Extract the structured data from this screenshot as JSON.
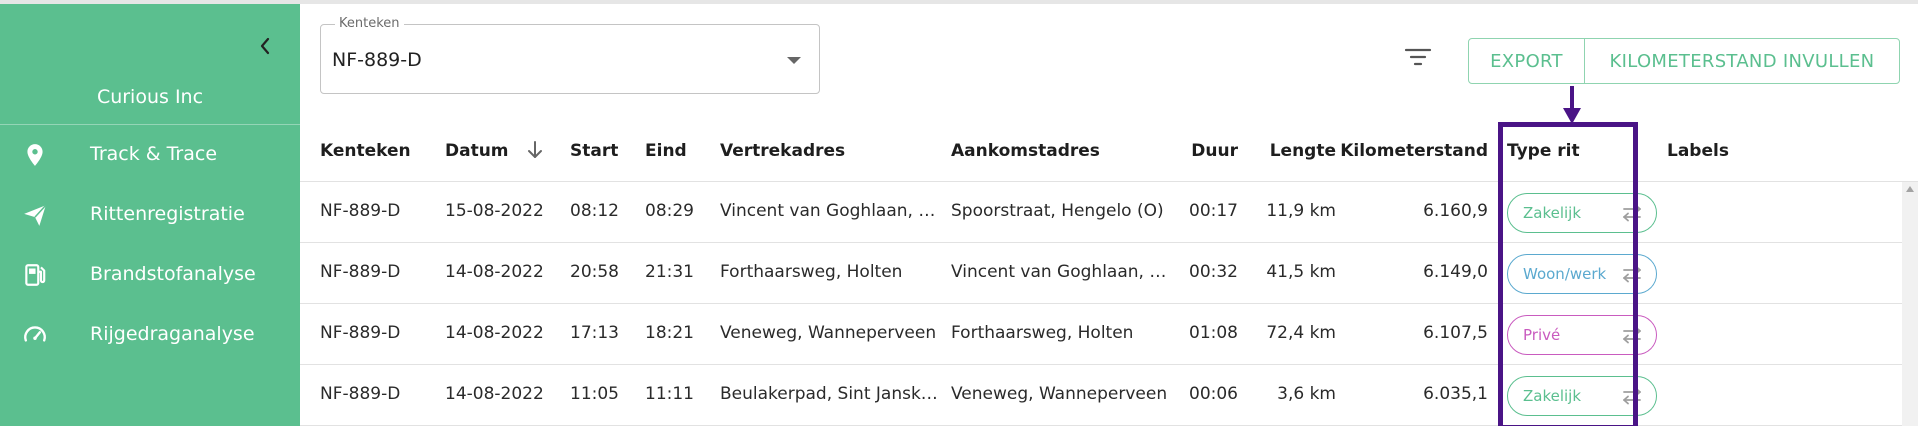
{
  "sidebar": {
    "company": "Curious Inc",
    "items": [
      {
        "label": "Track & Trace",
        "icon": "location-pin-icon"
      },
      {
        "label": "Rittenregistratie",
        "icon": "paper-plane-icon"
      },
      {
        "label": "Brandstofanalyse",
        "icon": "fuel-pump-icon"
      },
      {
        "label": "Rijgedraganalyse",
        "icon": "speedometer-icon"
      }
    ]
  },
  "filter": {
    "label": "Kenteken",
    "value": "NF-889-D"
  },
  "toolbar": {
    "export_label": "EXPORT",
    "km_label": "KILOMETERSTAND INVULLEN"
  },
  "table": {
    "headers": {
      "kenteken": "Kenteken",
      "datum": "Datum",
      "start": "Start",
      "eind": "Eind",
      "vertrek": "Vertrekadres",
      "aankomst": "Aankomstadres",
      "duur": "Duur",
      "lengte": "Lengte",
      "km": "Kilometerstand",
      "type": "Type rit",
      "labels": "Labels"
    },
    "rows": [
      {
        "kenteken": "NF-889-D",
        "datum": "15-08-2022",
        "start": "08:12",
        "eind": "08:29",
        "vertrek": "Vincent van Goghlaan, E...",
        "aankomst": "Spoorstraat, Hengelo (O)",
        "duur": "00:17",
        "lengte": "11,9 km",
        "km": "6.160,9",
        "type": "Zakelijk",
        "type_color": "#5bbf8f"
      },
      {
        "kenteken": "NF-889-D",
        "datum": "14-08-2022",
        "start": "20:58",
        "eind": "21:31",
        "vertrek": "Forthaarsweg, Holten",
        "aankomst": "Vincent van Goghlaan, E...",
        "duur": "00:32",
        "lengte": "41,5 km",
        "km": "6.149,0",
        "type": "Woon/werk",
        "type_color": "#5ba9cf"
      },
      {
        "kenteken": "NF-889-D",
        "datum": "14-08-2022",
        "start": "17:13",
        "eind": "18:21",
        "vertrek": "Veneweg, Wanneperveen",
        "aankomst": "Forthaarsweg, Holten",
        "duur": "01:08",
        "lengte": "72,4 km",
        "km": "6.107,5",
        "type": "Privé",
        "type_color": "#c95bbf"
      },
      {
        "kenteken": "NF-889-D",
        "datum": "14-08-2022",
        "start": "11:05",
        "eind": "11:11",
        "vertrek": "Beulakerpad, Sint Janskl...",
        "aankomst": "Veneweg, Wanneperveen",
        "duur": "00:06",
        "lengte": "3,6 km",
        "km": "6.035,1",
        "type": "Zakelijk",
        "type_color": "#5bbf8f"
      }
    ]
  },
  "colors": {
    "brand": "#5bbf8f",
    "annotation": "#4a1486"
  }
}
